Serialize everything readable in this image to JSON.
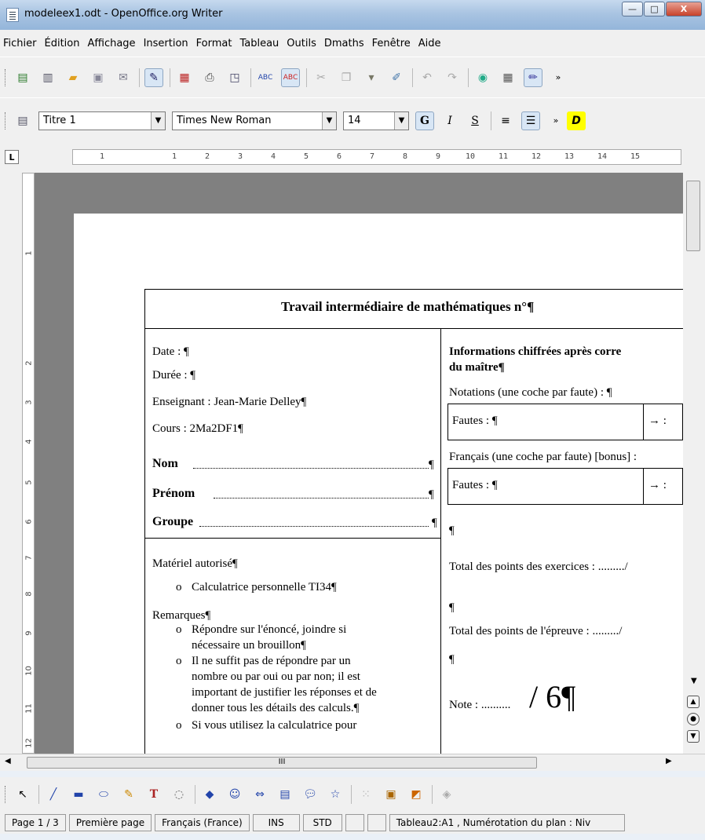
{
  "window": {
    "title": "modeleex1.odt - OpenOffice.org Writer",
    "buttons": {
      "minimize": "—",
      "maximize": "□",
      "close": "X"
    }
  },
  "menu": [
    {
      "label": "Fichier"
    },
    {
      "label": "Édition"
    },
    {
      "label": "Affichage"
    },
    {
      "label": "Insertion"
    },
    {
      "label": "Format"
    },
    {
      "label": "Tableau"
    },
    {
      "label": "Outils"
    },
    {
      "label": "Dmaths"
    },
    {
      "label": "Fenêtre"
    },
    {
      "label": "Aide"
    }
  ],
  "formatting": {
    "style": "Titre 1",
    "font": "Times New Roman",
    "size": "14",
    "bold_label": "G",
    "italic_label": "I",
    "underline_label": "S",
    "dmaths_label": "D"
  },
  "ruler": {
    "numbers": [
      "1",
      "1",
      "2",
      "3",
      "4",
      "5",
      "6",
      "7",
      "8",
      "9",
      "10",
      "11",
      "12",
      "13",
      "14",
      "15"
    ],
    "vertical_numbers": [
      "1",
      "2",
      "3",
      "4",
      "5",
      "6",
      "7",
      "8",
      "9",
      "10",
      "11",
      "12"
    ]
  },
  "document": {
    "title": "Travail intermédiaire de mathématiques n°¶",
    "left": {
      "date": "Date : ¶",
      "duree": "Durée : ¶",
      "enseignant": "Enseignant : Jean-Marie Delley¶",
      "cours": "Cours : 2Ma2DF1¶",
      "nom_label": "Nom",
      "prenom_label": "Prénom",
      "groupe_label": "Groupe",
      "materiel": "Matériel autorisé¶",
      "materiel_items": [
        "Calculatrice personnelle TI34¶"
      ],
      "remarques": "Remarques¶",
      "remarques_items": [
        "Répondre sur l'énoncé, joindre si",
        "nécessaire un brouillon¶",
        "Il ne suffit pas de répondre par un",
        "nombre ou par oui ou par non; il est",
        "important de justifier les réponses et de",
        "donner tous les détails des calculs.¶",
        "Si vous utilisez la calculatrice pour"
      ]
    },
    "right": {
      "info_title_1": "Informations chiffrées après corre",
      "info_title_2": "du maître¶",
      "notations": "Notations (une coche par faute) : ¶",
      "fautes_1": "Fautes : ¶",
      "arrow_1": "→ :",
      "francais": "Français (une coche par faute) [bonus] :",
      "fautes_2": "Fautes : ¶",
      "arrow_2": "→ :",
      "pilcrow_1": "¶",
      "total_exercices": "Total des points des exercices : ........./",
      "pilcrow_2": "¶",
      "total_epreuve": "Total des points de l'épreuve : ........./",
      "pilcrow_3": "¶",
      "note_label": "Note : ..........",
      "note_value": "/ 6¶"
    }
  },
  "status": {
    "page": "Page 1 / 3",
    "page_style": "Première page",
    "language": "Français (France)",
    "insert_mode": "INS",
    "selection_mode": "STD",
    "context": "Tableau2:A1 , Numérotation du plan : Niv"
  },
  "hscroll_label": "III",
  "icons": [
    "new-icon",
    "open-icon",
    "save-icon",
    "email-icon",
    "edit-icon",
    "pdf-icon",
    "print-icon",
    "preview-icon",
    "spellcheck-icon",
    "autospell-icon",
    "cut-icon",
    "copy-icon",
    "paste-icon",
    "format-paintbrush-icon",
    "undo-icon",
    "redo-icon",
    "navigator-icon",
    "table-icon",
    "draw-functions-icon"
  ],
  "colors": {
    "titlebar": "#a9c4e2",
    "workarea": "#808080",
    "chrome": "#f0f0f0",
    "close": "#c7422b",
    "dmaths_highlight": "#ffff00"
  }
}
